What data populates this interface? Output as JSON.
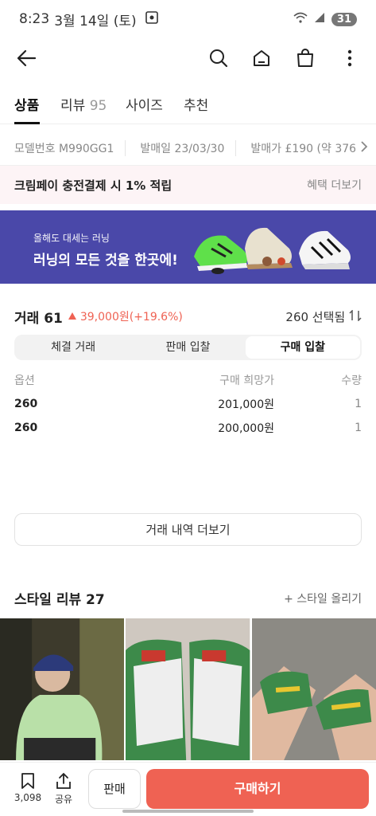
{
  "status_bar": {
    "time": "8:23",
    "date": "3월 14일 (토)",
    "battery": "31"
  },
  "tabs": [
    {
      "label": "상품",
      "count": ""
    },
    {
      "label": "리뷰",
      "count": "95"
    },
    {
      "label": "사이즈",
      "count": ""
    },
    {
      "label": "추천",
      "count": ""
    }
  ],
  "meta": {
    "model": "모델번호 M990GG1",
    "release": "발매일 23/03/30",
    "price": "발매가 £190 (약 376"
  },
  "benefit": {
    "title": "크림페이 충전결제 시 1% 적립",
    "more": "혜택 더보기"
  },
  "banner": {
    "subtitle": "올해도 대세는 러닝",
    "title": "러닝의 모든 것을 한곳에!"
  },
  "trade": {
    "label": "거래 61",
    "change": "39,000원(+19.6%)",
    "size_selector": "260 선택됨",
    "segments": [
      "체결 거래",
      "판매 입찰",
      "구매 입찰"
    ],
    "active_segment": 2,
    "columns": [
      "옵션",
      "구매 희망가",
      "수량"
    ],
    "rows": [
      {
        "option": "260",
        "price": "201,000원",
        "qty": "1"
      },
      {
        "option": "260",
        "price": "200,000원",
        "qty": "1"
      }
    ],
    "history_button": "거래 내역 더보기"
  },
  "style_review": {
    "title": "스타일 리뷰 27",
    "upload": "+ 스타일 올리기"
  },
  "bottom": {
    "bookmark_count": "3,098",
    "share_label": "공유",
    "sell_label": "판매",
    "buy_label": "구매하기"
  },
  "colors": {
    "accent": "#ef6253",
    "banner_bg": "#4a48a9"
  }
}
